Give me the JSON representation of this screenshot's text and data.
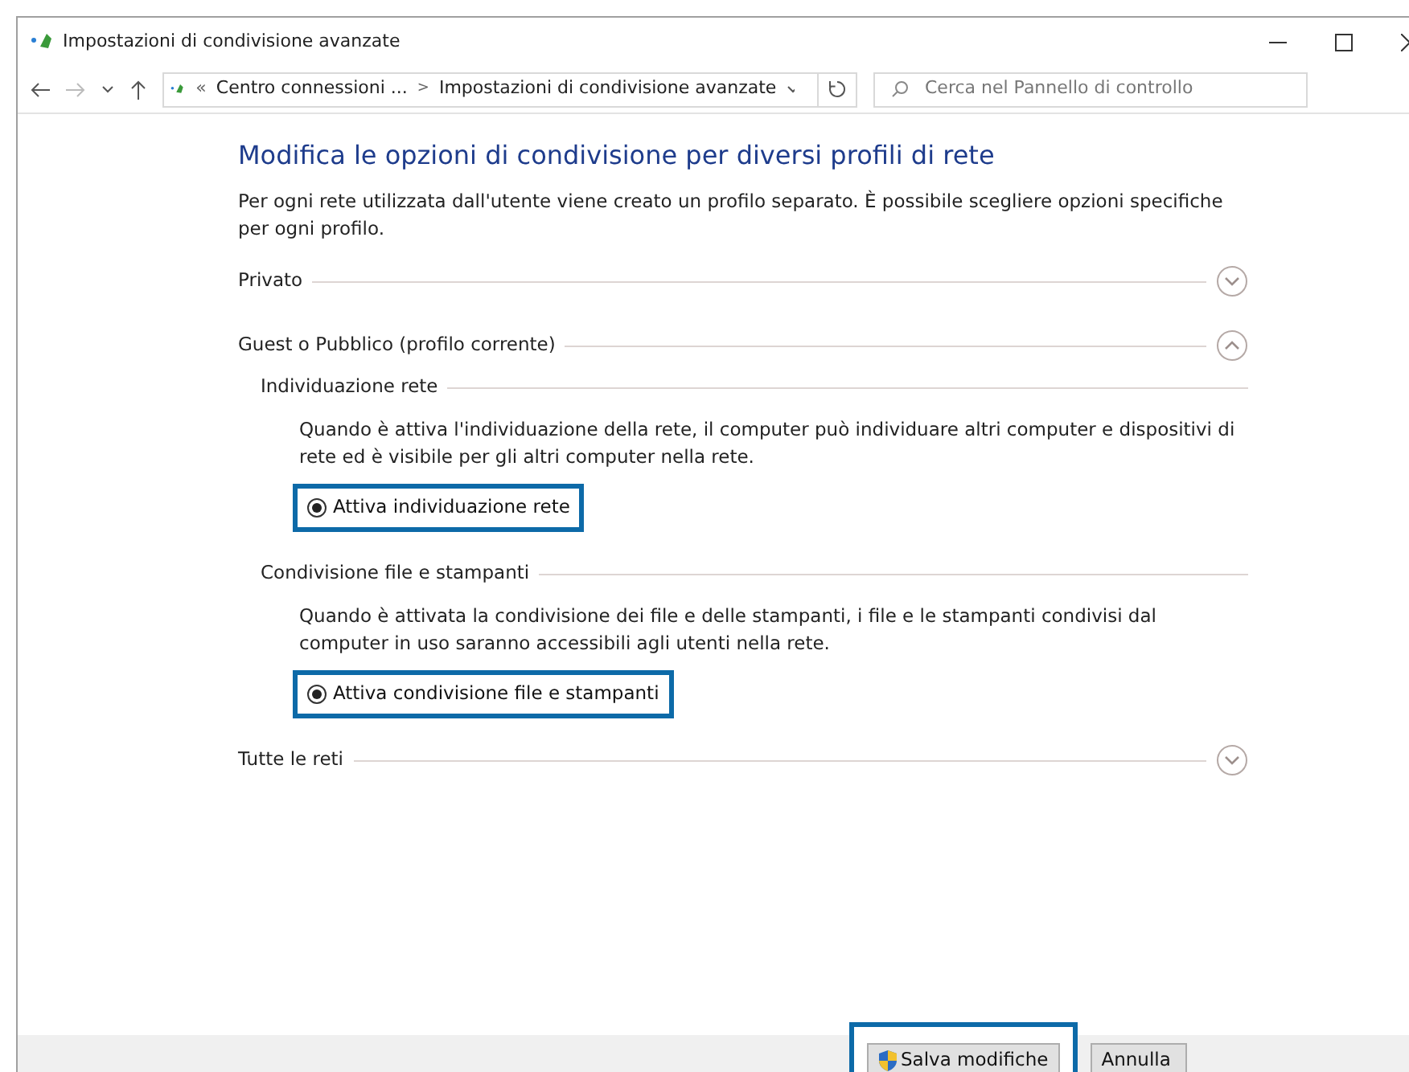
{
  "window": {
    "title": "Impostazioni di condivisione avanzate"
  },
  "address_bar": {
    "overflow": "«",
    "separator": ">",
    "crumbs": [
      "Centro connessioni ...",
      "Impostazioni di condivisione avanzate"
    ]
  },
  "search": {
    "placeholder": "Cerca nel Pannello di controllo"
  },
  "heading": "Modifica le opzioni di condivisione per diversi profili di rete",
  "intro": "Per ogni rete utilizzata dall'utente viene creato un profilo separato. È possibile scegliere opzioni specifiche per ogni profilo.",
  "profiles": [
    {
      "title": "Privato",
      "expanded": false
    },
    {
      "title": "Guest o Pubblico (profilo corrente)",
      "expanded": true,
      "sections": [
        {
          "title": "Individuazione rete",
          "description": "Quando è attiva l'individuazione della rete, il computer può individuare altri computer e dispositivi di rete ed è visibile per gli altri computer nella rete.",
          "options": [
            {
              "label": "Attiva individuazione rete",
              "selected": true,
              "highlighted": true
            }
          ]
        },
        {
          "title": "Condivisione file e stampanti",
          "description": "Quando è attivata la condivisione dei file e delle stampanti, i file e le stampanti condivisi dal computer in uso saranno accessibili agli utenti nella rete.",
          "options": [
            {
              "label": "Attiva condivisione file e stampanti",
              "selected": true,
              "highlighted": true
            }
          ]
        }
      ]
    },
    {
      "title": "Tutte le reti",
      "expanded": false
    }
  ],
  "buttons": [
    {
      "label": "Salva modifiche",
      "kind": "shield",
      "highlighted": true
    },
    {
      "label": "Annulla",
      "kind": "plain",
      "highlighted": false
    }
  ]
}
